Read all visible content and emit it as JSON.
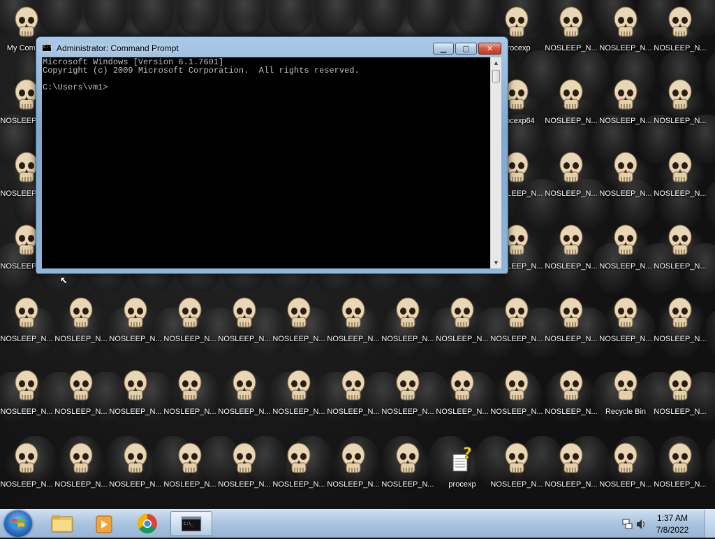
{
  "desktop": {
    "icons_top_right": [
      {
        "label": "My Comp..."
      },
      {
        "label": "procexp"
      },
      {
        "label": "NOSLEEP_N..."
      },
      {
        "label": "NOSLEEP_N..."
      },
      {
        "label": "NOSLEEP_N..."
      }
    ],
    "icon_label_default": "NOSLEEP_N...",
    "procexp64_label": "procexp64",
    "recycle_bin_label": "Recycle Bin",
    "procexp_label": "procexp"
  },
  "cmd": {
    "title": "Administrator: Command Prompt",
    "lines": [
      "Microsoft Windows [Version 6.1.7601]",
      "Copyright (c) 2009 Microsoft Corporation.  All rights reserved.",
      "",
      "C:\\Users\\vm1>"
    ],
    "colors": {
      "background": "#000000",
      "text": "#c0c0c0"
    }
  },
  "taskbar": {
    "time": "1:37 AM",
    "date": "7/8/2022",
    "pinned": [
      "start-orb-icon",
      "folder-icon",
      "media-player-icon",
      "chrome-icon",
      "cmd-icon"
    ]
  }
}
